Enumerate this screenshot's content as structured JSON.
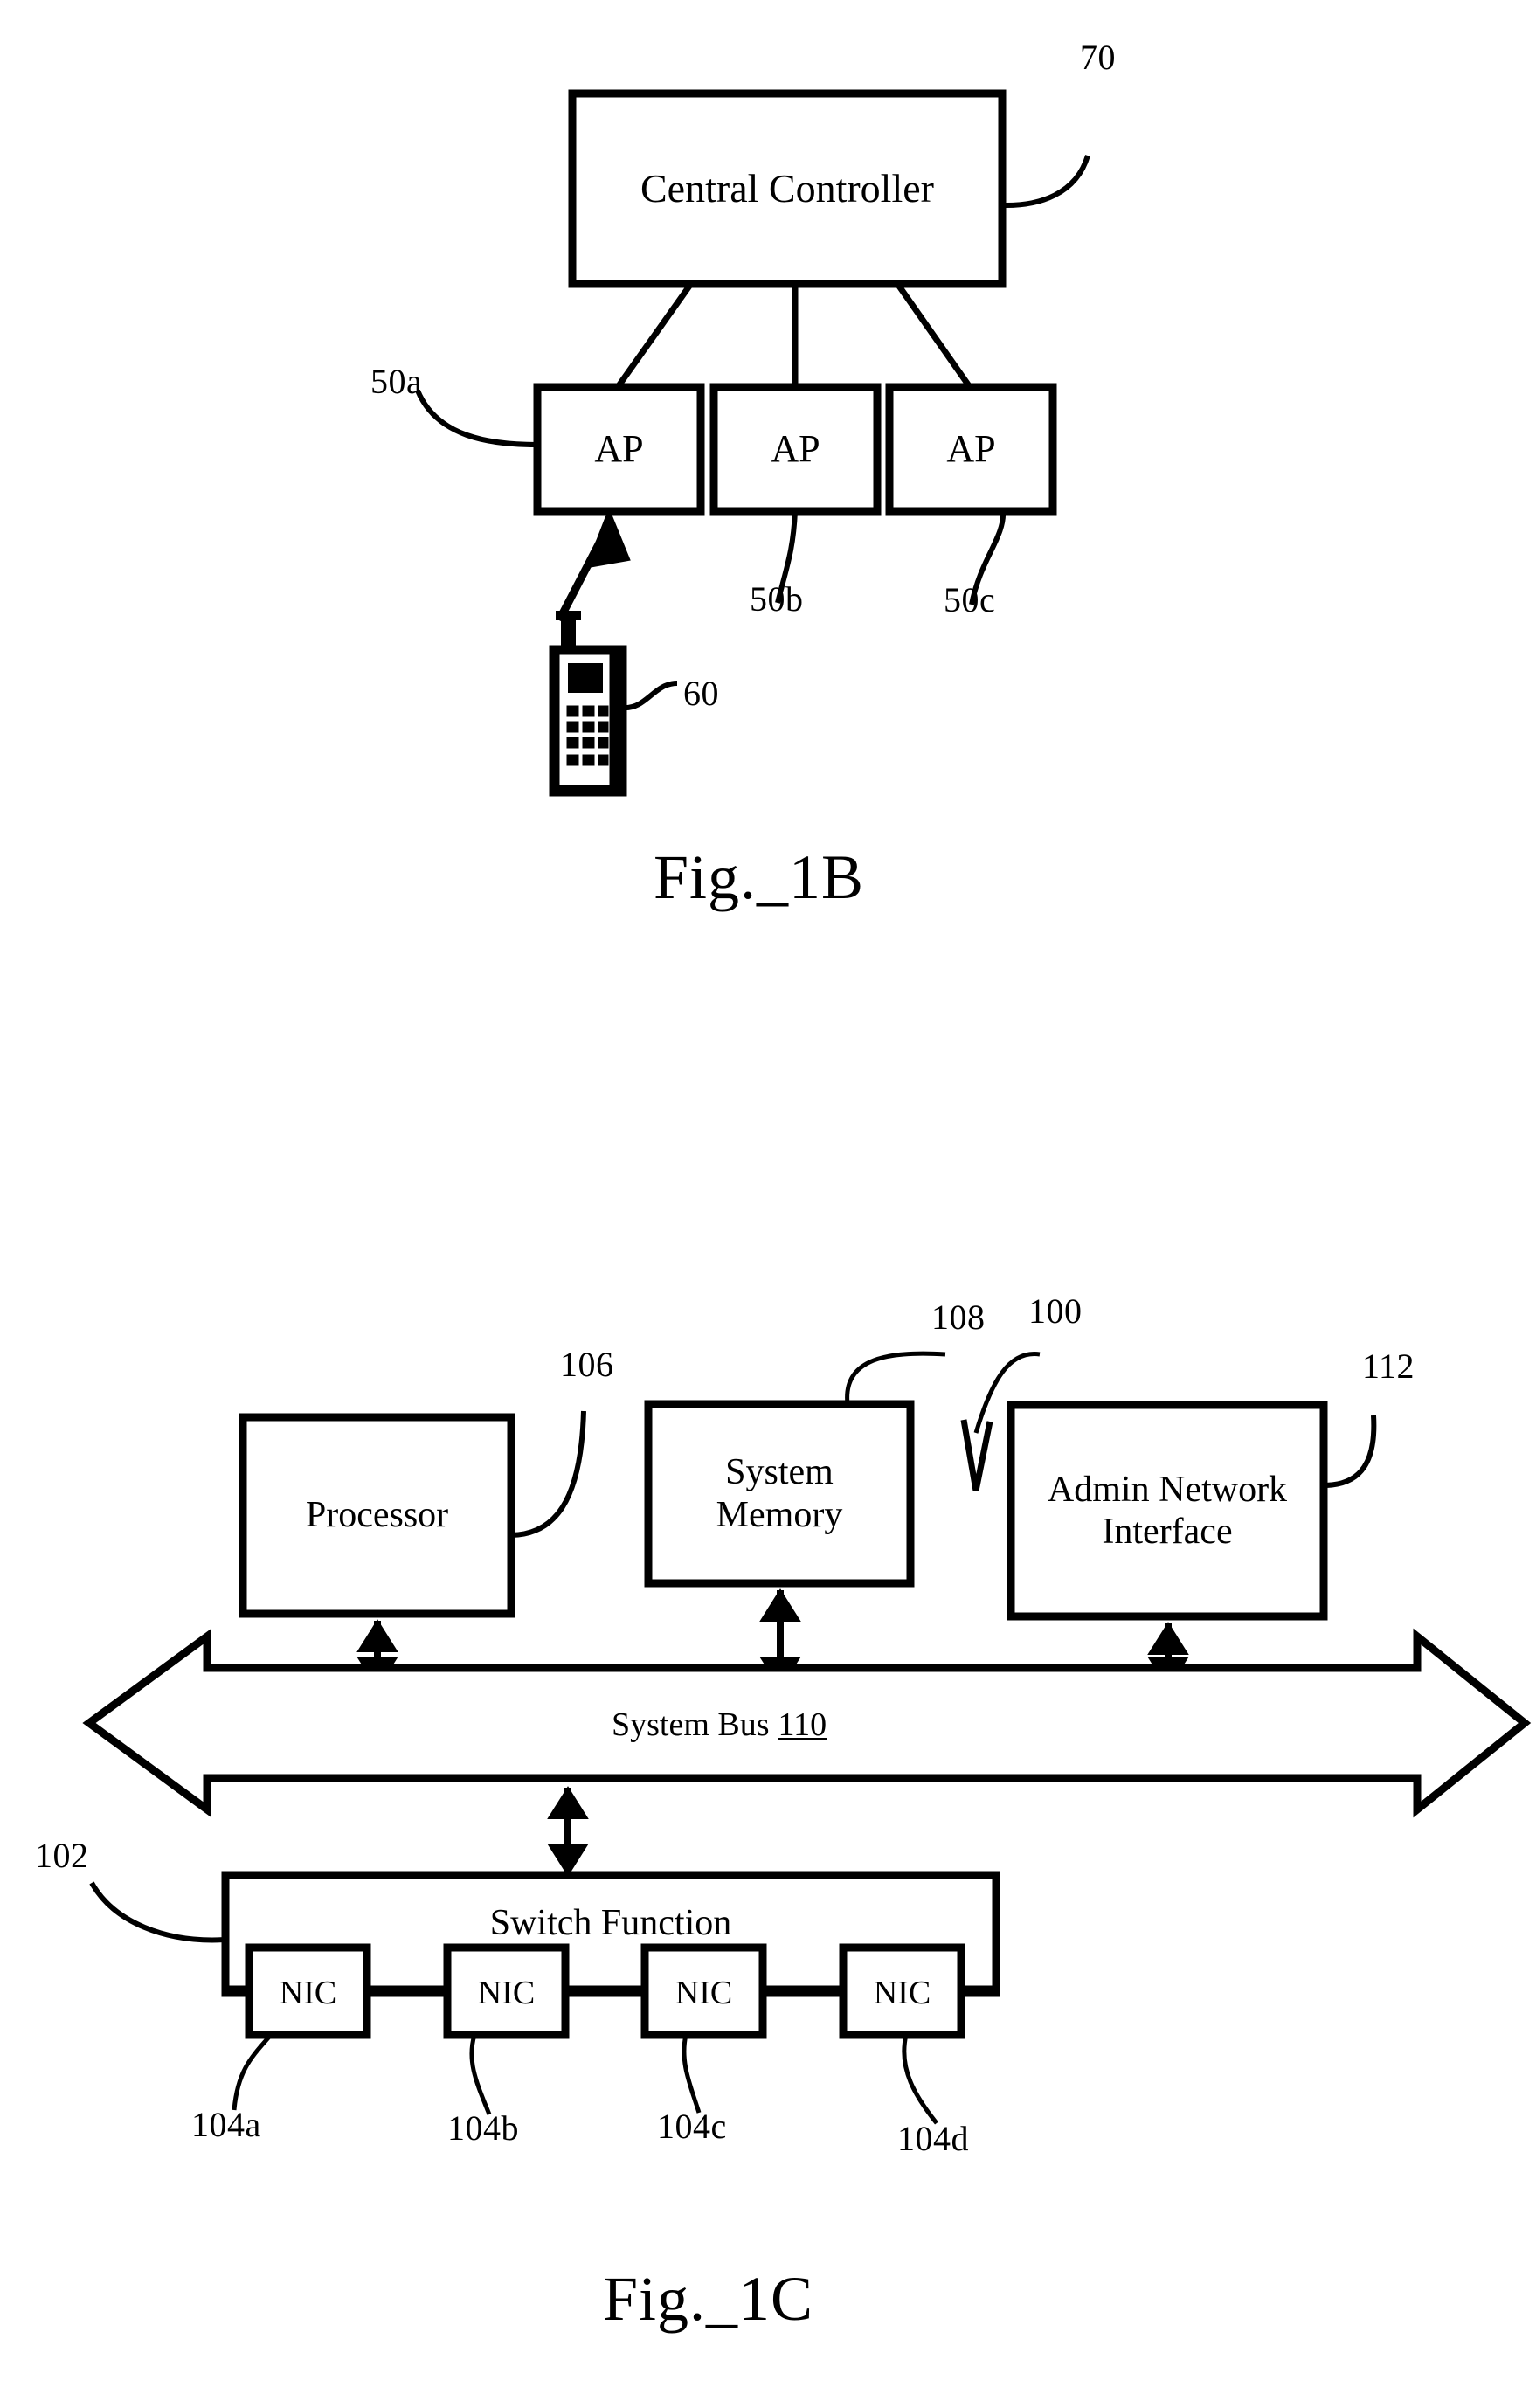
{
  "document": {
    "type": "patent-drawing-sheet",
    "figures": [
      {
        "caption": "Fig._1B",
        "nodes": [
          {
            "id": "central-controller",
            "label": "Central Controller",
            "ref": "70"
          },
          {
            "id": "ap-1",
            "label": "AP",
            "ref": "50a"
          },
          {
            "id": "ap-2",
            "label": "AP",
            "ref": "50b"
          },
          {
            "id": "ap-3",
            "label": "AP",
            "ref": "50c"
          },
          {
            "id": "mobile-station",
            "label": "",
            "ref": "60"
          }
        ]
      },
      {
        "caption": "Fig._1C",
        "nodes": [
          {
            "id": "processor",
            "label": "Processor",
            "ref": "106"
          },
          {
            "id": "system-memory",
            "label": "System\nMemory",
            "ref": "108"
          },
          {
            "id": "admin-network-interface",
            "label": "Admin Network\nInterface",
            "ref": "112"
          },
          {
            "id": "system-bus",
            "label": "System Bus",
            "ref": "110"
          },
          {
            "id": "switch-function",
            "label": "Switch Function",
            "ref": "102"
          },
          {
            "id": "nic-1",
            "label": "NIC",
            "ref": "104a"
          },
          {
            "id": "nic-2",
            "label": "NIC",
            "ref": "104b"
          },
          {
            "id": "nic-3",
            "label": "NIC",
            "ref": "104c"
          },
          {
            "id": "nic-4",
            "label": "NIC",
            "ref": "104d"
          },
          {
            "id": "apparatus",
            "label": "",
            "ref": "100"
          }
        ]
      }
    ]
  },
  "fig1b": {
    "caption": "Fig._1B",
    "central_controller": {
      "label": "Central Controller",
      "ref": "70"
    },
    "ap_a": {
      "label": "AP",
      "ref": "50a"
    },
    "ap_b": {
      "label": "AP",
      "ref": "50b"
    },
    "ap_c": {
      "label": "AP",
      "ref": "50c"
    },
    "mobile": {
      "ref": "60",
      "icon": "mobile-phone-icon"
    }
  },
  "fig1c": {
    "caption": "Fig._1C",
    "system_ref": "100",
    "processor": {
      "label": "Processor",
      "ref": "106"
    },
    "system_memory": {
      "label": "System\nMemory",
      "ref": "108"
    },
    "admin_network_interface": {
      "label": "Admin Network\nInterface",
      "ref": "112"
    },
    "system_bus": {
      "label": "System Bus",
      "ref": "110"
    },
    "switch_function": {
      "label": "Switch Function",
      "ref": "102"
    },
    "nics": [
      {
        "label": "NIC",
        "ref": "104a"
      },
      {
        "label": "NIC",
        "ref": "104b"
      },
      {
        "label": "NIC",
        "ref": "104c"
      },
      {
        "label": "NIC",
        "ref": "104d"
      }
    ]
  },
  "colors": {
    "ink": "#000000",
    "paper": "#ffffff"
  }
}
